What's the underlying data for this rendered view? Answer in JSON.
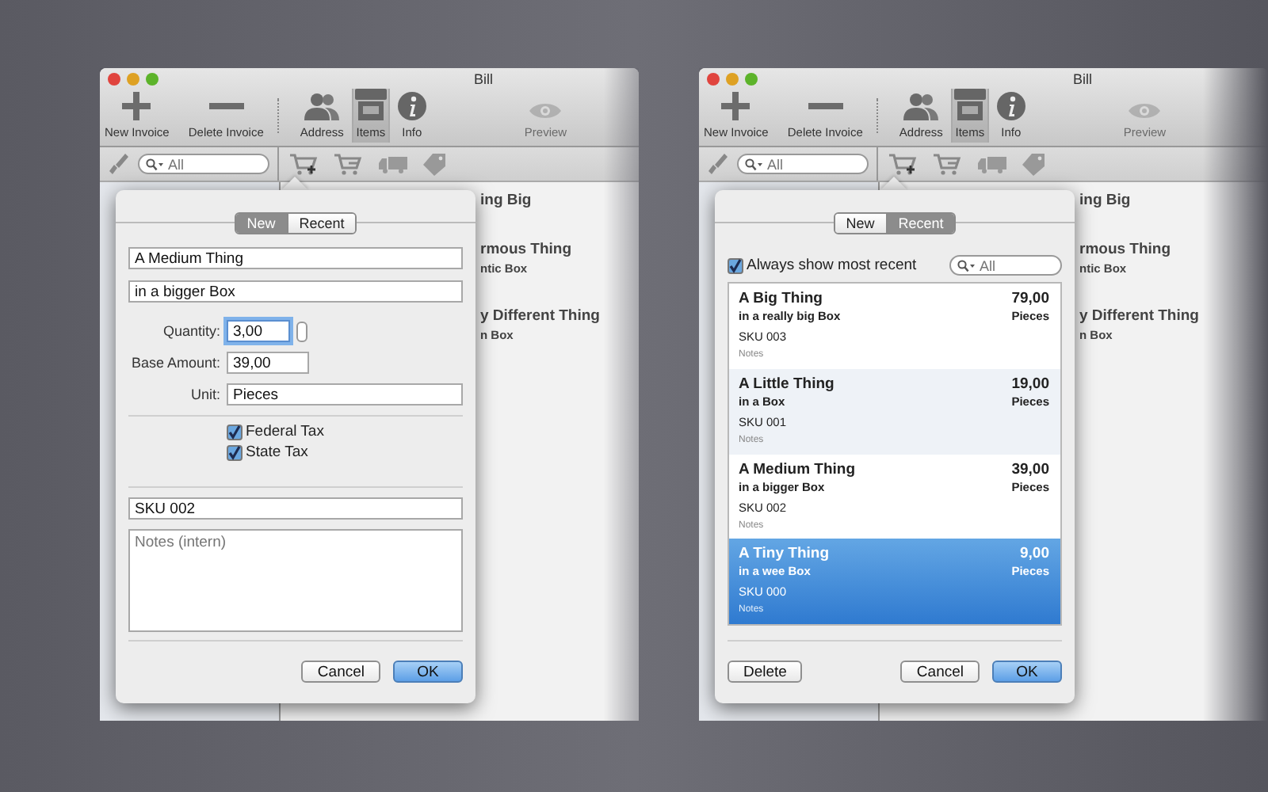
{
  "windows": [
    {
      "title": "Bill",
      "toolbar": [
        {
          "label": "New Invoice",
          "selected": false,
          "disabled": false
        },
        {
          "label": "Delete Invoice",
          "selected": false,
          "disabled": false
        },
        {
          "label": "Address",
          "selected": false,
          "disabled": false
        },
        {
          "label": "Items",
          "selected": true,
          "disabled": false
        },
        {
          "label": "Info",
          "selected": false,
          "disabled": false
        },
        {
          "label": "Preview",
          "selected": false,
          "disabled": true
        }
      ],
      "sidebar_search": {
        "placeholder": "All"
      },
      "items_behind": [
        {
          "title": "ing Big"
        },
        {
          "title": "rmous Thing",
          "subtitle": "ntic Box"
        },
        {
          "title": "y Different Thing",
          "subtitle": "n Box"
        }
      ],
      "popover": {
        "kind": "new",
        "tabs": [
          {
            "label": "New",
            "selected": true
          },
          {
            "label": "Recent",
            "selected": false
          }
        ],
        "name": {
          "value": "A Medium Thing"
        },
        "description": {
          "value": "in a bigger Box"
        },
        "quantity": {
          "label": "Quantity:",
          "value": "3,00",
          "focused": true
        },
        "base_amount": {
          "label": "Base Amount:",
          "value": "39,00"
        },
        "unit": {
          "label": "Unit:",
          "value": "Pieces"
        },
        "taxes": [
          {
            "label": "Federal Tax",
            "checked": true
          },
          {
            "label": "State Tax",
            "checked": true
          }
        ],
        "sku": {
          "value": "SKU 002"
        },
        "notes": {
          "placeholder": "Notes (intern)"
        },
        "buttons": [
          {
            "label": "Cancel",
            "default": false
          },
          {
            "label": "OK",
            "default": true
          }
        ]
      }
    },
    {
      "title": "Bill",
      "toolbar": [
        {
          "label": "New Invoice",
          "selected": false,
          "disabled": false
        },
        {
          "label": "Delete Invoice",
          "selected": false,
          "disabled": false
        },
        {
          "label": "Address",
          "selected": false,
          "disabled": false
        },
        {
          "label": "Items",
          "selected": true,
          "disabled": false
        },
        {
          "label": "Info",
          "selected": false,
          "disabled": false
        },
        {
          "label": "Preview",
          "selected": false,
          "disabled": true
        }
      ],
      "sidebar_search": {
        "placeholder": "All"
      },
      "items_behind": [
        {
          "title": "ing Big"
        },
        {
          "title": "rmous Thing",
          "subtitle": "ntic Box"
        },
        {
          "title": "y Different Thing",
          "subtitle": "n Box"
        }
      ],
      "popover": {
        "kind": "recent",
        "tabs": [
          {
            "label": "New",
            "selected": false
          },
          {
            "label": "Recent",
            "selected": true
          }
        ],
        "always_recent": {
          "label": "Always show most recent",
          "checked": true
        },
        "search": {
          "placeholder": "All"
        },
        "items": [
          {
            "title": "A Big Thing",
            "subtitle": "in a really big Box",
            "sku": "SKU 003",
            "notes": "Notes",
            "price": "79,00",
            "unit": "Pieces",
            "selected": false
          },
          {
            "title": "A Little Thing",
            "subtitle": "in a Box",
            "sku": "SKU 001",
            "notes": "Notes",
            "price": "19,00",
            "unit": "Pieces",
            "selected": false
          },
          {
            "title": "A Medium Thing",
            "subtitle": "in a bigger Box",
            "sku": "SKU 002",
            "notes": "Notes",
            "price": "39,00",
            "unit": "Pieces",
            "selected": false
          },
          {
            "title": "A Tiny Thing",
            "subtitle": "in a wee Box",
            "sku": "SKU 000",
            "notes": "Notes",
            "price": "9,00",
            "unit": "Pieces",
            "selected": true
          }
        ],
        "buttons": [
          {
            "label": "Delete",
            "default": false
          },
          {
            "label": "Cancel",
            "default": false
          },
          {
            "label": "OK",
            "default": true
          }
        ]
      }
    }
  ]
}
